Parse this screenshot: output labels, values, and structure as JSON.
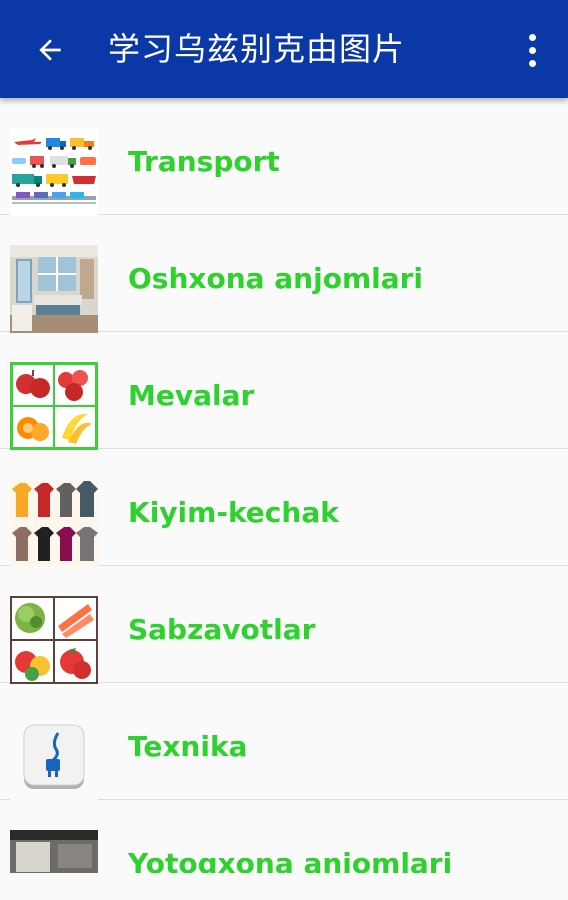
{
  "appbar": {
    "title": "学习乌兹别克由图片",
    "back_icon": "arrow-back-icon",
    "menu_icon": "more-vert-icon",
    "color": "#0a38a6"
  },
  "list": {
    "label_color": "#2ed12e",
    "items": [
      {
        "label": "Transport",
        "icon": "transport-thumbnail"
      },
      {
        "label": "Oshxona anjomlari",
        "icon": "kitchen-thumbnail"
      },
      {
        "label": "Mevalar",
        "icon": "fruits-thumbnail"
      },
      {
        "label": "Kiyim-kechak",
        "icon": "clothes-thumbnail"
      },
      {
        "label": "Sabzavotlar",
        "icon": "vegetables-thumbnail"
      },
      {
        "label": "Texnika",
        "icon": "plug-thumbnail"
      },
      {
        "label": "Yotoqxona anjomlari",
        "icon": "bedroom-thumbnail"
      }
    ]
  }
}
